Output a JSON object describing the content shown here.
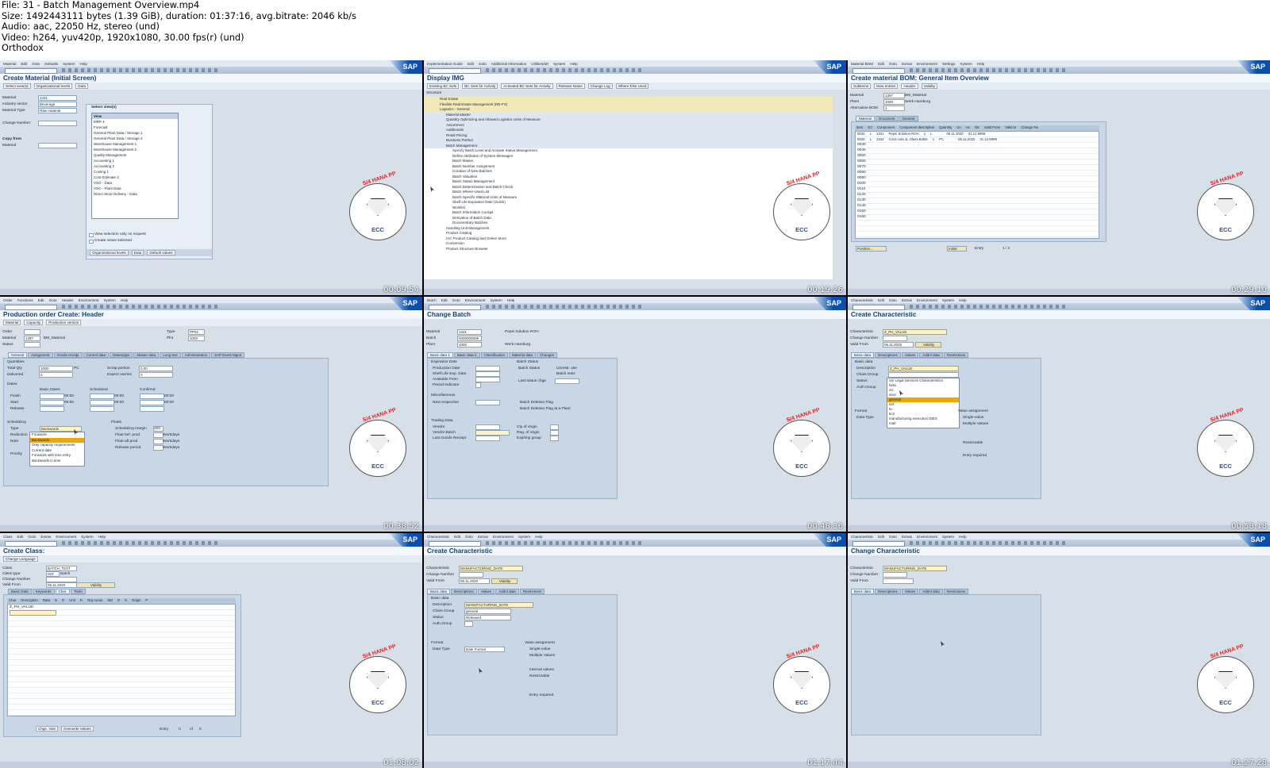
{
  "header": {
    "lines": [
      "File: 31 - Batch Management Overview.mp4",
      "Size: 1492443111 bytes (1.39 GiB), duration: 01:37:16, avg.bitrate: 2046 kb/s",
      "Audio: aac, 22050 Hz, stereo (und)",
      "Video: h264, yuv420p, 1920x1080, 30.00 fps(r) (und)",
      "Orthodox"
    ]
  },
  "sap_logo_text": "SAP",
  "badge": {
    "top_text": "S/4 HANA PP",
    "bottom_text": "ECC"
  },
  "thumbnails": [
    {
      "timestamp": "00:09:54",
      "menu": [
        "Material",
        "Edit",
        "Goto",
        "Defaults",
        "System",
        "Help"
      ],
      "title": "Create Material (Initial Screen)",
      "app_toolbar": [
        "Select view(s)",
        "Organizational levels",
        "Data"
      ],
      "fields": [
        {
          "label": "Material",
          "value": "1341"
        },
        {
          "label": "Industry sector",
          "value": "Beverage"
        },
        {
          "label": "Material Type",
          "value": "Raw material"
        },
        {
          "label": "Change Number",
          "value": ""
        }
      ],
      "section": "Copy from",
      "section_field": "Material",
      "popup_title": "Select view(s)",
      "popup_header": "View",
      "popup_items": [
        "MRP 4",
        "Forecast",
        "General Plant Data / Storage 1",
        "General Plant Data / Storage 2",
        "Warehouse Management 1",
        "Warehouse Management 2",
        "Quality Management",
        "Accounting 1",
        "Accounting 2",
        "Costing 1",
        "Cost Estimate 2",
        "VSO - Data",
        "VSO - Plant Data",
        "Direct Store Delivery - Data"
      ],
      "popup_checks": [
        "View selection only on request",
        "Create views selected"
      ],
      "popup_buttons": [
        "Organizational levels",
        "Data",
        "Default values"
      ]
    },
    {
      "timestamp": "00:19:26",
      "menu": [
        "Implementation Guide",
        "Edit",
        "Goto",
        "Additional Information",
        "Utilities(M)",
        "System",
        "Help"
      ],
      "title": "Display IMG",
      "app_toolbar": [
        "Existing BC Sets",
        "BC Sets for Activity",
        "Activated BC Sets for Activity",
        "Release Notes",
        "Change Log",
        "Where Else Used"
      ],
      "tree_header": "Structure",
      "tree": [
        "Real Estate",
        "Flexible Real Estate Management (RE-FX)",
        "Logistics - General",
        "Material Master",
        "Quantity Optimizing and Allowed Logistics Units of Measure",
        "Assortment",
        "Additionals",
        "Retail Pricing",
        "Business Partner",
        "Batch Management",
        "Specify Batch Level and Activate Status Management",
        "Define Attributes of System Messages",
        "Batch Master",
        "Batch Number Assignment",
        "Creation of New Batches",
        "Batch Valuation",
        "Batch Status Management",
        "Batch Determination and Batch Check",
        "Batch Where-Used List",
        "Batch-Specific Material Units of Measure",
        "Shelf Life Expiration Date (SLED)",
        "Worklist",
        "Batch Information Cockpit",
        "Derivation of Batch Data",
        "Documentary Batches",
        "Handling Unit Management",
        "Product Catalog",
        "IAC Product Catalog and Online Store",
        "Conversion",
        "Product Structure Browser"
      ]
    },
    {
      "timestamp": "00:29:10",
      "menu": [
        "Material BOM",
        "Edit",
        "Goto",
        "Extras",
        "Environment",
        "Settings",
        "System",
        "Help"
      ],
      "title": "Create material BOM: General Item Overview",
      "app_toolbar": [
        "Subitems",
        "New entries",
        "Header",
        "Validity"
      ],
      "fields": [
        {
          "label": "Material",
          "value": "1397",
          "text": "BM_Material"
        },
        {
          "label": "Plant",
          "value": "1000",
          "text": "Werk Hamburg"
        },
        {
          "label": "Alternative BOM",
          "value": "1",
          "text": ""
        }
      ],
      "tabs": [
        "Material",
        "Document",
        "General"
      ],
      "columns": [
        "Item",
        "ICt",
        "Component",
        "Component description",
        "Quantity",
        "Un",
        "As",
        "Sls",
        "Valid From",
        "Valid to",
        "Change No"
      ],
      "rows": [
        [
          "0010",
          "L",
          "1341",
          "Pepsi Solution ROH",
          "1",
          "L",
          "",
          "",
          "06.11.2020",
          "31.12.9999",
          ""
        ],
        [
          "0020",
          "L",
          "1342",
          "Coca cola 1L Glass Bottle",
          "1",
          "PC",
          "",
          "",
          "06.11.2020",
          "31.12.9999",
          ""
        ]
      ],
      "item_numbers": [
        "0030",
        "0040",
        "0050",
        "0060",
        "0070",
        "0080",
        "0090",
        "0100",
        "0110",
        "0120",
        "0130",
        "0140",
        "0150",
        "0160"
      ],
      "bottom_buttons": [
        "Position...",
        "Initial"
      ],
      "entry_label": "Entry",
      "entry_value": "1 / 2"
    },
    {
      "timestamp": "00:38:52",
      "menu": [
        "Order",
        "Functions",
        "Edit",
        "Goto",
        "Header",
        "Environment",
        "System",
        "Help"
      ],
      "title": "Production order Create: Header",
      "app_toolbar": [
        "Material",
        "Capacity",
        "Production version"
      ],
      "fields": [
        {
          "label": "Order",
          "value": ""
        },
        {
          "label": "Material",
          "value": "1397",
          "text": "BM_Material"
        },
        {
          "label": "Status",
          "value": ""
        },
        {
          "label": "Type",
          "value": "PP01"
        },
        {
          "label": "Plnt",
          "value": "1000"
        }
      ],
      "tabs": [
        "General",
        "Assignment",
        "Goods receipt",
        "Control data",
        "Dates/qtys",
        "Master data",
        "Long text",
        "Administration",
        "SAP Event Mgmt"
      ],
      "quantities_title": "Quantities",
      "quantities": [
        {
          "label": "Total Qty",
          "value": "1000",
          "unit": "PC"
        },
        {
          "label": "Delivered",
          "value": "0"
        },
        {
          "label": "Scrap portion",
          "value": "0.00"
        },
        {
          "label": "Expect.Var/Ins",
          "value": "0"
        }
      ],
      "dates_title": "Dates",
      "dates_cols": [
        "Basic Dates",
        "Scheduled",
        "Confirmd"
      ],
      "dates_rows": [
        "Finish",
        "Start",
        "Release"
      ],
      "time_value": "00:00",
      "scheduling_title": "Scheduling",
      "scheduling_labels": [
        "Type",
        "Reduction",
        "Note",
        "Priority"
      ],
      "scheduling_type": "Backwards",
      "dropdown": [
        "Forwards",
        "Backwards",
        "Only capacity requirements",
        "Current date",
        "Forwards with time entry",
        "Backwards in time"
      ],
      "floats_title": "Floats",
      "floats": [
        "Scheduling margin",
        "Float bef. prod.",
        "Float aft.prod",
        "Release period"
      ],
      "floats_unit": "Workdays",
      "floats_margin_value": "000"
    },
    {
      "timestamp": "00:48:36",
      "menu": [
        "Batch",
        "Edit",
        "Goto",
        "Environment",
        "System",
        "Help"
      ],
      "title": "Change Batch",
      "fields": [
        {
          "label": "Material",
          "value": "1341",
          "text": "Pepsi Solution ROH"
        },
        {
          "label": "Batch",
          "value": "0000000509"
        },
        {
          "label": "Plant",
          "value": "1000",
          "text": "Werk Hamburg"
        }
      ],
      "tabs": [
        "Basic data 1",
        "Basic data 2",
        "Classification",
        "Material data",
        "Changes"
      ],
      "expiration_title": "Expiration Date",
      "expiration": [
        "Production Date",
        "Shelf Life Exp. Date",
        "Available From",
        "Period Indicator"
      ],
      "status_title": "Batch Status",
      "status_options": [
        "Unrestr. use",
        "Batch restr."
      ],
      "status_label": "Batch Status",
      "last_status_chg": "Last status chge",
      "misc_title": "Miscellaneous",
      "misc": [
        "Next Inspection"
      ],
      "misc_checks": [
        "Batch Deletion Flag",
        "Batch Deletion Flag at a Plant"
      ],
      "trading_title": "Trading Data",
      "trading_left": [
        "Vendor",
        "Vendor Batch",
        "Last Goods Receipt"
      ],
      "trading_right": [
        "Cty of origin",
        "Reg. of origin",
        "Exp/imp group"
      ]
    },
    {
      "timestamp": "00:58:18",
      "menu": [
        "Characteristic",
        "Edit",
        "Goto",
        "Extras",
        "Environment",
        "System",
        "Help"
      ],
      "title": "Create Characteristic",
      "fields": [
        {
          "label": "Characteristic",
          "value": "Z_PH_VALUE"
        },
        {
          "label": "Change Number",
          "value": ""
        },
        {
          "label": "Valid From",
          "value": "06.11.2020"
        }
      ],
      "validity_button": "Validity",
      "tabs": [
        "Basic data",
        "Descriptions",
        "Values",
        "Addnl data",
        "Restrictions"
      ],
      "basic_title": "Basic data",
      "basic": [
        "Description",
        "Chars Group",
        "Status",
        "Auth.Group"
      ],
      "description_value": "Z_PH_VALUE",
      "list": [
        "US Legal Services Characteristics",
        "beta",
        "cls",
        "door",
        "general",
        "ind",
        "kc",
        "kc2",
        "manufacturing execution IDES",
        "matl"
      ],
      "list_selected": "general",
      "format_title": "Format",
      "format_label": "Data Type",
      "value_assignment_title": "Value assignment",
      "value_options": [
        "Single-value",
        "Multiple Values"
      ],
      "value_checks": [
        "Restrictable",
        "Entry required"
      ]
    },
    {
      "timestamp": "01:08:02",
      "menu": [
        "Class",
        "Edit",
        "Goto",
        "Extras",
        "Environment",
        "System",
        "Help"
      ],
      "title": "Create Class:",
      "app_toolbar": [
        "Change Language"
      ],
      "fields": [
        {
          "label": "Class",
          "value": "BATCH_TEST"
        },
        {
          "label": "Class type",
          "value": "023",
          "text": "Batch"
        },
        {
          "label": "Change Number",
          "value": ""
        },
        {
          "label": "Valid From",
          "value": "06.11.2020"
        }
      ],
      "validity_button": "Validity",
      "tabs": [
        "Basic Data",
        "Keywords",
        "Char.",
        "Texts"
      ],
      "columns": [
        "Char",
        "Description",
        "Data",
        "N",
        "D",
        "Unit",
        "R",
        "Org Areas",
        "Std",
        "O",
        "S",
        "Origin",
        "P"
      ],
      "first_char": "Z_PH_VALUE",
      "bottom_buttons": [
        "Chgs. Vals",
        "Overwrite Values"
      ],
      "entry_label": "Entry",
      "entry_value": "0",
      "entry_of": "of",
      "entry_total": "0"
    },
    {
      "timestamp": "01:17:44",
      "menu": [
        "Characteristic",
        "Edit",
        "Goto",
        "Extras",
        "Environment",
        "System",
        "Help"
      ],
      "title": "Create Characteristic",
      "fields": [
        {
          "label": "Characteristic",
          "value": "MANUFACTURING_DATE"
        },
        {
          "label": "Change Number",
          "value": ""
        },
        {
          "label": "Valid From",
          "value": "06.11.2020"
        }
      ],
      "validity_button": "Validity",
      "tabs": [
        "Basic data",
        "Descriptions",
        "Values",
        "Addnl data",
        "Restrictions"
      ],
      "basic_title": "Basic data",
      "basic": [
        {
          "label": "Description",
          "value": "MANUFACTURING_DATE"
        },
        {
          "label": "Chars Group",
          "value": "general"
        },
        {
          "label": "Status",
          "value": "Released"
        },
        {
          "label": "Auth.Group",
          "value": ""
        }
      ],
      "format_title": "Format",
      "format_label": "Data Type",
      "format_value": "Date Format",
      "value_assignment_title": "Value assignment",
      "value_options": [
        "Single-value",
        "Multiple Values"
      ],
      "value_checks": [
        "Interval values",
        "Restrictable",
        "Entry required"
      ]
    },
    {
      "timestamp": "01:27:28",
      "menu": [
        "Characteristic",
        "Edit",
        "Goto",
        "Extras",
        "Environment",
        "System",
        "Help"
      ],
      "title": "Change Characteristic",
      "fields": [
        {
          "label": "Characteristic",
          "value": "MANUFACTURING_DATE"
        },
        {
          "label": "Change Number",
          "value": ""
        },
        {
          "label": "Valid From",
          "value": ""
        }
      ],
      "tabs": [
        "Basic data",
        "Descriptions",
        "Values",
        "Addnl data",
        "Restrictions"
      ]
    }
  ]
}
